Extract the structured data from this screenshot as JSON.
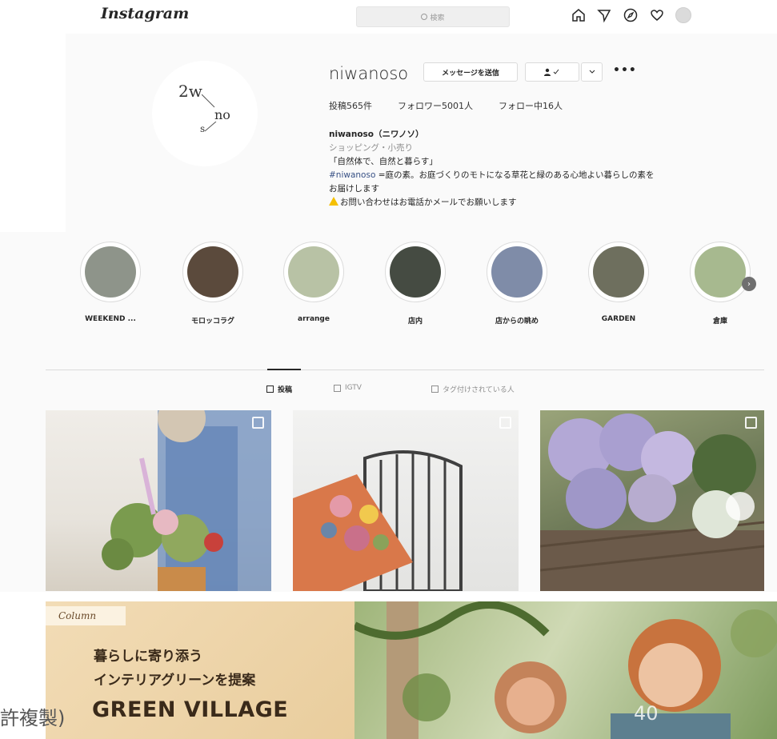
{
  "header": {
    "logo": "Instagram",
    "search_placeholder": "検索",
    "nav_icons": [
      "home-icon",
      "direct-icon",
      "explore-icon",
      "heart-icon",
      "avatar-icon"
    ]
  },
  "profile": {
    "pic_text": [
      "2w",
      "no",
      "s"
    ],
    "username": "niwanoso",
    "message_button": "メッセージを送信",
    "follow_status_icon": "person-check-icon",
    "stats": {
      "posts": "投稿565件",
      "followers": "フォロワー5001人",
      "following": "フォロー中16人"
    },
    "bio": {
      "name": "niwanoso（ニワノソ）",
      "category": "ショッピング・小売り",
      "line1": "「自然体で、自然と暮らす」",
      "hashtag": "#niwanoso",
      "line2": " =庭の素。お庭づくりのモトになる草花と緑のある心地よい暮らしの素を",
      "line3": "お届けします",
      "line4": "お問い合わせはお電話かメールでお願いします"
    }
  },
  "highlights": [
    {
      "label": "WEEKEND ...",
      "color": "#8e948a"
    },
    {
      "label": "モロッコラグ",
      "color": "#5b4a3c"
    },
    {
      "label": "arrange",
      "color": "#b8c2a5"
    },
    {
      "label": "店内",
      "color": "#454b42"
    },
    {
      "label": "店からの眺め",
      "color": "#7f8ca8"
    },
    {
      "label": "GARDEN",
      "color": "#6e6f5e"
    },
    {
      "label": "倉庫",
      "color": "#a7b98f"
    }
  ],
  "tabs": {
    "posts": "投稿",
    "igtv": "IGTV",
    "tagged": "タグ付けされている人"
  },
  "banner": {
    "column": "Column",
    "line1": "暮らしに寄り添う",
    "line2": "インテリアグリーンを提案",
    "title": "GREEN VILLAGE"
  },
  "footer": {
    "copyright": "許複製)",
    "page_number": "40"
  }
}
